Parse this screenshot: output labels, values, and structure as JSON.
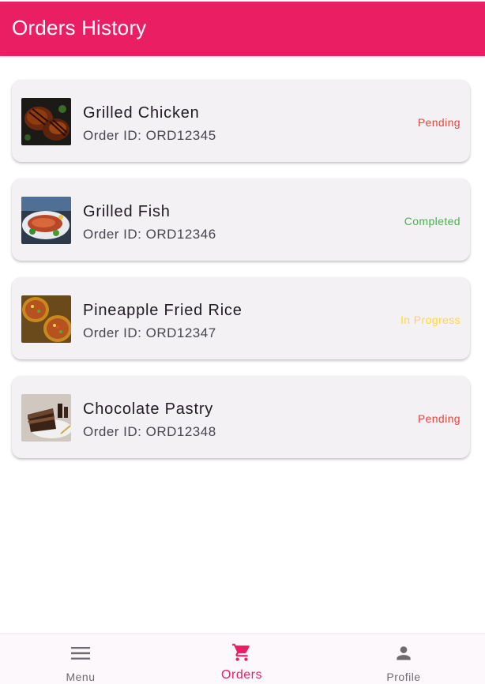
{
  "appbar": {
    "title": "Orders History",
    "color": "#e91e63"
  },
  "orders": [
    {
      "name": "Grilled Chicken",
      "order_id": "Order ID: ORD12345",
      "status": "Pending",
      "status_color": "#e0483d",
      "image": "grilled-chicken-image"
    },
    {
      "name": "Grilled Fish",
      "order_id": "Order ID: ORD12346",
      "status": "Completed",
      "status_color": "#4caf50",
      "image": "grilled-fish-image"
    },
    {
      "name": "Pineapple Fried Rice",
      "order_id": "Order ID: ORD12347",
      "status": "In Progress",
      "status_color": "#ffd83a",
      "image": "pineapple-fried-rice-image"
    },
    {
      "name": "Chocolate Pastry",
      "order_id": "Order ID: ORD12348",
      "status": "Pending",
      "status_color": "#e0483d",
      "image": "chocolate-pastry-image"
    }
  ],
  "bottom_nav": {
    "items": [
      {
        "label": "Menu",
        "icon": "menu-icon",
        "active": false
      },
      {
        "label": "Orders",
        "icon": "shopping-cart-icon",
        "active": true
      },
      {
        "label": "Profile",
        "icon": "person-icon",
        "active": false
      }
    ],
    "active_color": "#e91e63",
    "inactive_color": "#6f6a70"
  }
}
